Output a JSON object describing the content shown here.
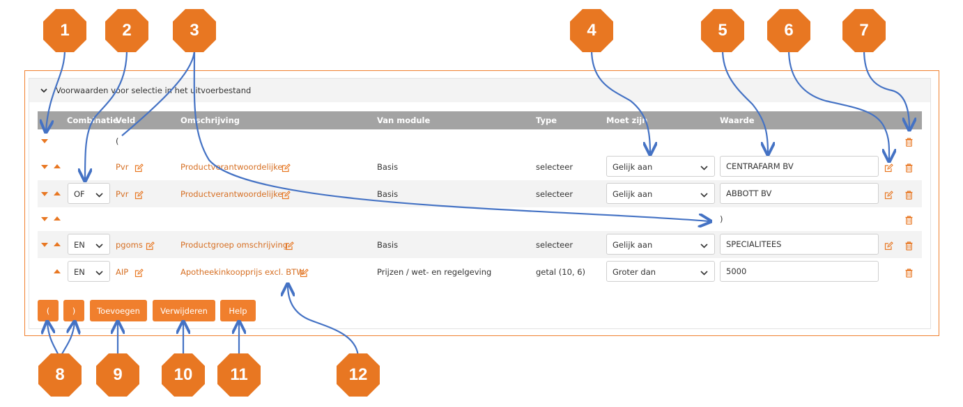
{
  "panel": {
    "title": "Voorwaarden voor selectie in het uitvoerbestand"
  },
  "columns": {
    "combinatie": "Combinatie",
    "veld": "Veld",
    "omschrijving": "Omschrijving",
    "van_module": "Van module",
    "type": "Type",
    "moet_zijn": "Moet zijn",
    "waarde": "Waarde"
  },
  "rows": [
    {
      "veld": "("
    },
    {
      "veld": "Pvr",
      "omschrijving": "Productverantwoordelijke",
      "module": "Basis",
      "type": "selecteer",
      "moet_zijn": "Gelijk aan",
      "waarde": "CENTRAFARM BV"
    },
    {
      "combinatie": "OF",
      "veld": "Pvr",
      "omschrijving": "Productverantwoordelijke",
      "module": "Basis",
      "type": "selecteer",
      "moet_zijn": "Gelijk aan",
      "waarde": "ABBOTT BV"
    },
    {
      "close": ")"
    },
    {
      "combinatie": "EN",
      "veld": "pgoms",
      "omschrijving": "Productgroep omschrijving",
      "module": "Basis",
      "type": "selecteer",
      "moet_zijn": "Gelijk aan",
      "waarde": "SPECIALITEES"
    },
    {
      "combinatie": "EN",
      "veld": "AIP",
      "omschrijving": "Apotheekinkoopprijs excl. BTW",
      "module": "Prijzen / wet- en regelgeving",
      "type": "getal (10, 6)",
      "moet_zijn": "Groter dan",
      "waarde": "5000"
    }
  ],
  "buttons": {
    "open_paren": "(",
    "close_paren": ")",
    "toevoegen": "Toevoegen",
    "verwijderen": "Verwijderen",
    "help": "Help"
  },
  "callouts": [
    "1",
    "2",
    "3",
    "4",
    "5",
    "6",
    "7",
    "8",
    "9",
    "10",
    "11",
    "12"
  ],
  "colors": {
    "accent": "#f07f2d",
    "callout": "#e87722",
    "arrow": "#4472c4",
    "header": "#a3a3a3"
  },
  "icons": [
    "chevron-down-icon",
    "arrow-down-icon",
    "arrow-up-icon",
    "edit-icon",
    "trash-icon"
  ]
}
